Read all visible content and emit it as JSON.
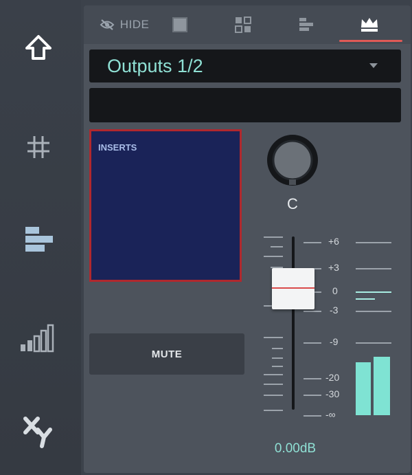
{
  "sidebar": {
    "items": [
      {
        "icon": "home-icon"
      },
      {
        "icon": "grid-icon"
      },
      {
        "icon": "mixer-icon"
      },
      {
        "icon": "signal-bars-icon"
      },
      {
        "icon": "xy-icon"
      }
    ]
  },
  "topbar": {
    "hide_label": "HIDE",
    "tabs": [
      {
        "icon": "single-view-icon"
      },
      {
        "icon": "four-view-icon"
      },
      {
        "icon": "channel-strip-icon"
      },
      {
        "icon": "crown-icon",
        "active": true
      }
    ]
  },
  "channel": {
    "output": "Outputs 1/2",
    "inserts_label": "INSERTS",
    "mute_label": "MUTE",
    "pan_label": "C",
    "db_value": "0.00dB",
    "scale": [
      "+6",
      "+3",
      "0",
      "-3",
      "-9",
      "-20",
      "-30",
      "-∞"
    ],
    "fader_level_db": 0,
    "meter_levels": [
      0.64,
      0.71
    ]
  },
  "colors": {
    "accent": "#8fe0d4",
    "active_tab": "#e05a56",
    "inserts_border": "#b0282e",
    "inserts_bg": "#1a2358",
    "meter": "#7fe3d3"
  }
}
